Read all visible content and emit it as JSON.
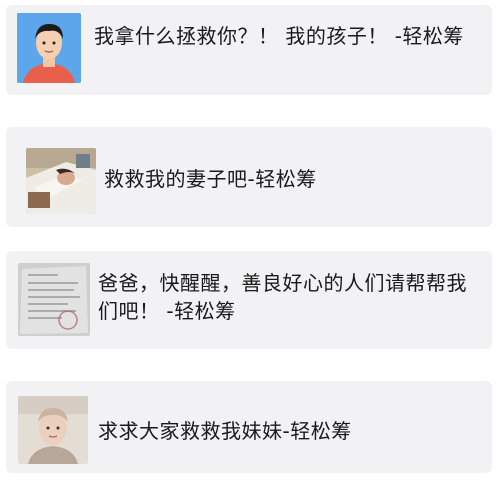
{
  "posts": [
    {
      "text": "我拿什么拯救你？！ 我的孩子！ -轻松筹",
      "image": "boy-portrait-photo"
    },
    {
      "text": "救救我的妻子吧-轻松筹",
      "image": "hospital-bed-photo"
    },
    {
      "text": "爸爸，快醒醒，善良好心的人们请帮帮我们吧！ -轻松筹",
      "image": "medical-document-photo"
    },
    {
      "text": "求求大家救救我妹妹-轻松筹",
      "image": "girl-portrait-photo"
    }
  ]
}
